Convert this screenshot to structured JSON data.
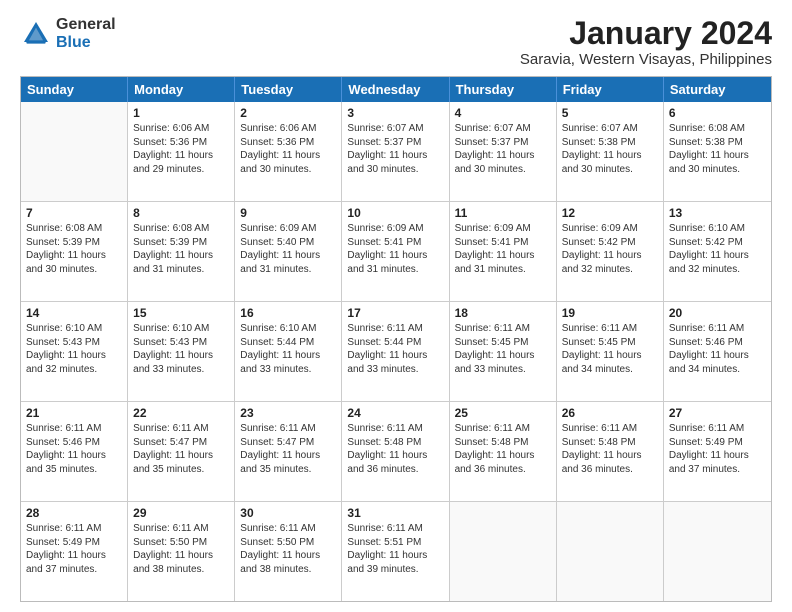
{
  "logo": {
    "general": "General",
    "blue": "Blue"
  },
  "title": "January 2024",
  "subtitle": "Saravia, Western Visayas, Philippines",
  "days": [
    "Sunday",
    "Monday",
    "Tuesday",
    "Wednesday",
    "Thursday",
    "Friday",
    "Saturday"
  ],
  "weeks": [
    [
      {
        "day": "",
        "lines": []
      },
      {
        "day": "1",
        "lines": [
          "Sunrise: 6:06 AM",
          "Sunset: 5:36 PM",
          "Daylight: 11 hours",
          "and 29 minutes."
        ]
      },
      {
        "day": "2",
        "lines": [
          "Sunrise: 6:06 AM",
          "Sunset: 5:36 PM",
          "Daylight: 11 hours",
          "and 30 minutes."
        ]
      },
      {
        "day": "3",
        "lines": [
          "Sunrise: 6:07 AM",
          "Sunset: 5:37 PM",
          "Daylight: 11 hours",
          "and 30 minutes."
        ]
      },
      {
        "day": "4",
        "lines": [
          "Sunrise: 6:07 AM",
          "Sunset: 5:37 PM",
          "Daylight: 11 hours",
          "and 30 minutes."
        ]
      },
      {
        "day": "5",
        "lines": [
          "Sunrise: 6:07 AM",
          "Sunset: 5:38 PM",
          "Daylight: 11 hours",
          "and 30 minutes."
        ]
      },
      {
        "day": "6",
        "lines": [
          "Sunrise: 6:08 AM",
          "Sunset: 5:38 PM",
          "Daylight: 11 hours",
          "and 30 minutes."
        ]
      }
    ],
    [
      {
        "day": "7",
        "lines": [
          "Sunrise: 6:08 AM",
          "Sunset: 5:39 PM",
          "Daylight: 11 hours",
          "and 30 minutes."
        ]
      },
      {
        "day": "8",
        "lines": [
          "Sunrise: 6:08 AM",
          "Sunset: 5:39 PM",
          "Daylight: 11 hours",
          "and 31 minutes."
        ]
      },
      {
        "day": "9",
        "lines": [
          "Sunrise: 6:09 AM",
          "Sunset: 5:40 PM",
          "Daylight: 11 hours",
          "and 31 minutes."
        ]
      },
      {
        "day": "10",
        "lines": [
          "Sunrise: 6:09 AM",
          "Sunset: 5:41 PM",
          "Daylight: 11 hours",
          "and 31 minutes."
        ]
      },
      {
        "day": "11",
        "lines": [
          "Sunrise: 6:09 AM",
          "Sunset: 5:41 PM",
          "Daylight: 11 hours",
          "and 31 minutes."
        ]
      },
      {
        "day": "12",
        "lines": [
          "Sunrise: 6:09 AM",
          "Sunset: 5:42 PM",
          "Daylight: 11 hours",
          "and 32 minutes."
        ]
      },
      {
        "day": "13",
        "lines": [
          "Sunrise: 6:10 AM",
          "Sunset: 5:42 PM",
          "Daylight: 11 hours",
          "and 32 minutes."
        ]
      }
    ],
    [
      {
        "day": "14",
        "lines": [
          "Sunrise: 6:10 AM",
          "Sunset: 5:43 PM",
          "Daylight: 11 hours",
          "and 32 minutes."
        ]
      },
      {
        "day": "15",
        "lines": [
          "Sunrise: 6:10 AM",
          "Sunset: 5:43 PM",
          "Daylight: 11 hours",
          "and 33 minutes."
        ]
      },
      {
        "day": "16",
        "lines": [
          "Sunrise: 6:10 AM",
          "Sunset: 5:44 PM",
          "Daylight: 11 hours",
          "and 33 minutes."
        ]
      },
      {
        "day": "17",
        "lines": [
          "Sunrise: 6:11 AM",
          "Sunset: 5:44 PM",
          "Daylight: 11 hours",
          "and 33 minutes."
        ]
      },
      {
        "day": "18",
        "lines": [
          "Sunrise: 6:11 AM",
          "Sunset: 5:45 PM",
          "Daylight: 11 hours",
          "and 33 minutes."
        ]
      },
      {
        "day": "19",
        "lines": [
          "Sunrise: 6:11 AM",
          "Sunset: 5:45 PM",
          "Daylight: 11 hours",
          "and 34 minutes."
        ]
      },
      {
        "day": "20",
        "lines": [
          "Sunrise: 6:11 AM",
          "Sunset: 5:46 PM",
          "Daylight: 11 hours",
          "and 34 minutes."
        ]
      }
    ],
    [
      {
        "day": "21",
        "lines": [
          "Sunrise: 6:11 AM",
          "Sunset: 5:46 PM",
          "Daylight: 11 hours",
          "and 35 minutes."
        ]
      },
      {
        "day": "22",
        "lines": [
          "Sunrise: 6:11 AM",
          "Sunset: 5:47 PM",
          "Daylight: 11 hours",
          "and 35 minutes."
        ]
      },
      {
        "day": "23",
        "lines": [
          "Sunrise: 6:11 AM",
          "Sunset: 5:47 PM",
          "Daylight: 11 hours",
          "and 35 minutes."
        ]
      },
      {
        "day": "24",
        "lines": [
          "Sunrise: 6:11 AM",
          "Sunset: 5:48 PM",
          "Daylight: 11 hours",
          "and 36 minutes."
        ]
      },
      {
        "day": "25",
        "lines": [
          "Sunrise: 6:11 AM",
          "Sunset: 5:48 PM",
          "Daylight: 11 hours",
          "and 36 minutes."
        ]
      },
      {
        "day": "26",
        "lines": [
          "Sunrise: 6:11 AM",
          "Sunset: 5:48 PM",
          "Daylight: 11 hours",
          "and 36 minutes."
        ]
      },
      {
        "day": "27",
        "lines": [
          "Sunrise: 6:11 AM",
          "Sunset: 5:49 PM",
          "Daylight: 11 hours",
          "and 37 minutes."
        ]
      }
    ],
    [
      {
        "day": "28",
        "lines": [
          "Sunrise: 6:11 AM",
          "Sunset: 5:49 PM",
          "Daylight: 11 hours",
          "and 37 minutes."
        ]
      },
      {
        "day": "29",
        "lines": [
          "Sunrise: 6:11 AM",
          "Sunset: 5:50 PM",
          "Daylight: 11 hours",
          "and 38 minutes."
        ]
      },
      {
        "day": "30",
        "lines": [
          "Sunrise: 6:11 AM",
          "Sunset: 5:50 PM",
          "Daylight: 11 hours",
          "and 38 minutes."
        ]
      },
      {
        "day": "31",
        "lines": [
          "Sunrise: 6:11 AM",
          "Sunset: 5:51 PM",
          "Daylight: 11 hours",
          "and 39 minutes."
        ]
      },
      {
        "day": "",
        "lines": []
      },
      {
        "day": "",
        "lines": []
      },
      {
        "day": "",
        "lines": []
      }
    ]
  ]
}
